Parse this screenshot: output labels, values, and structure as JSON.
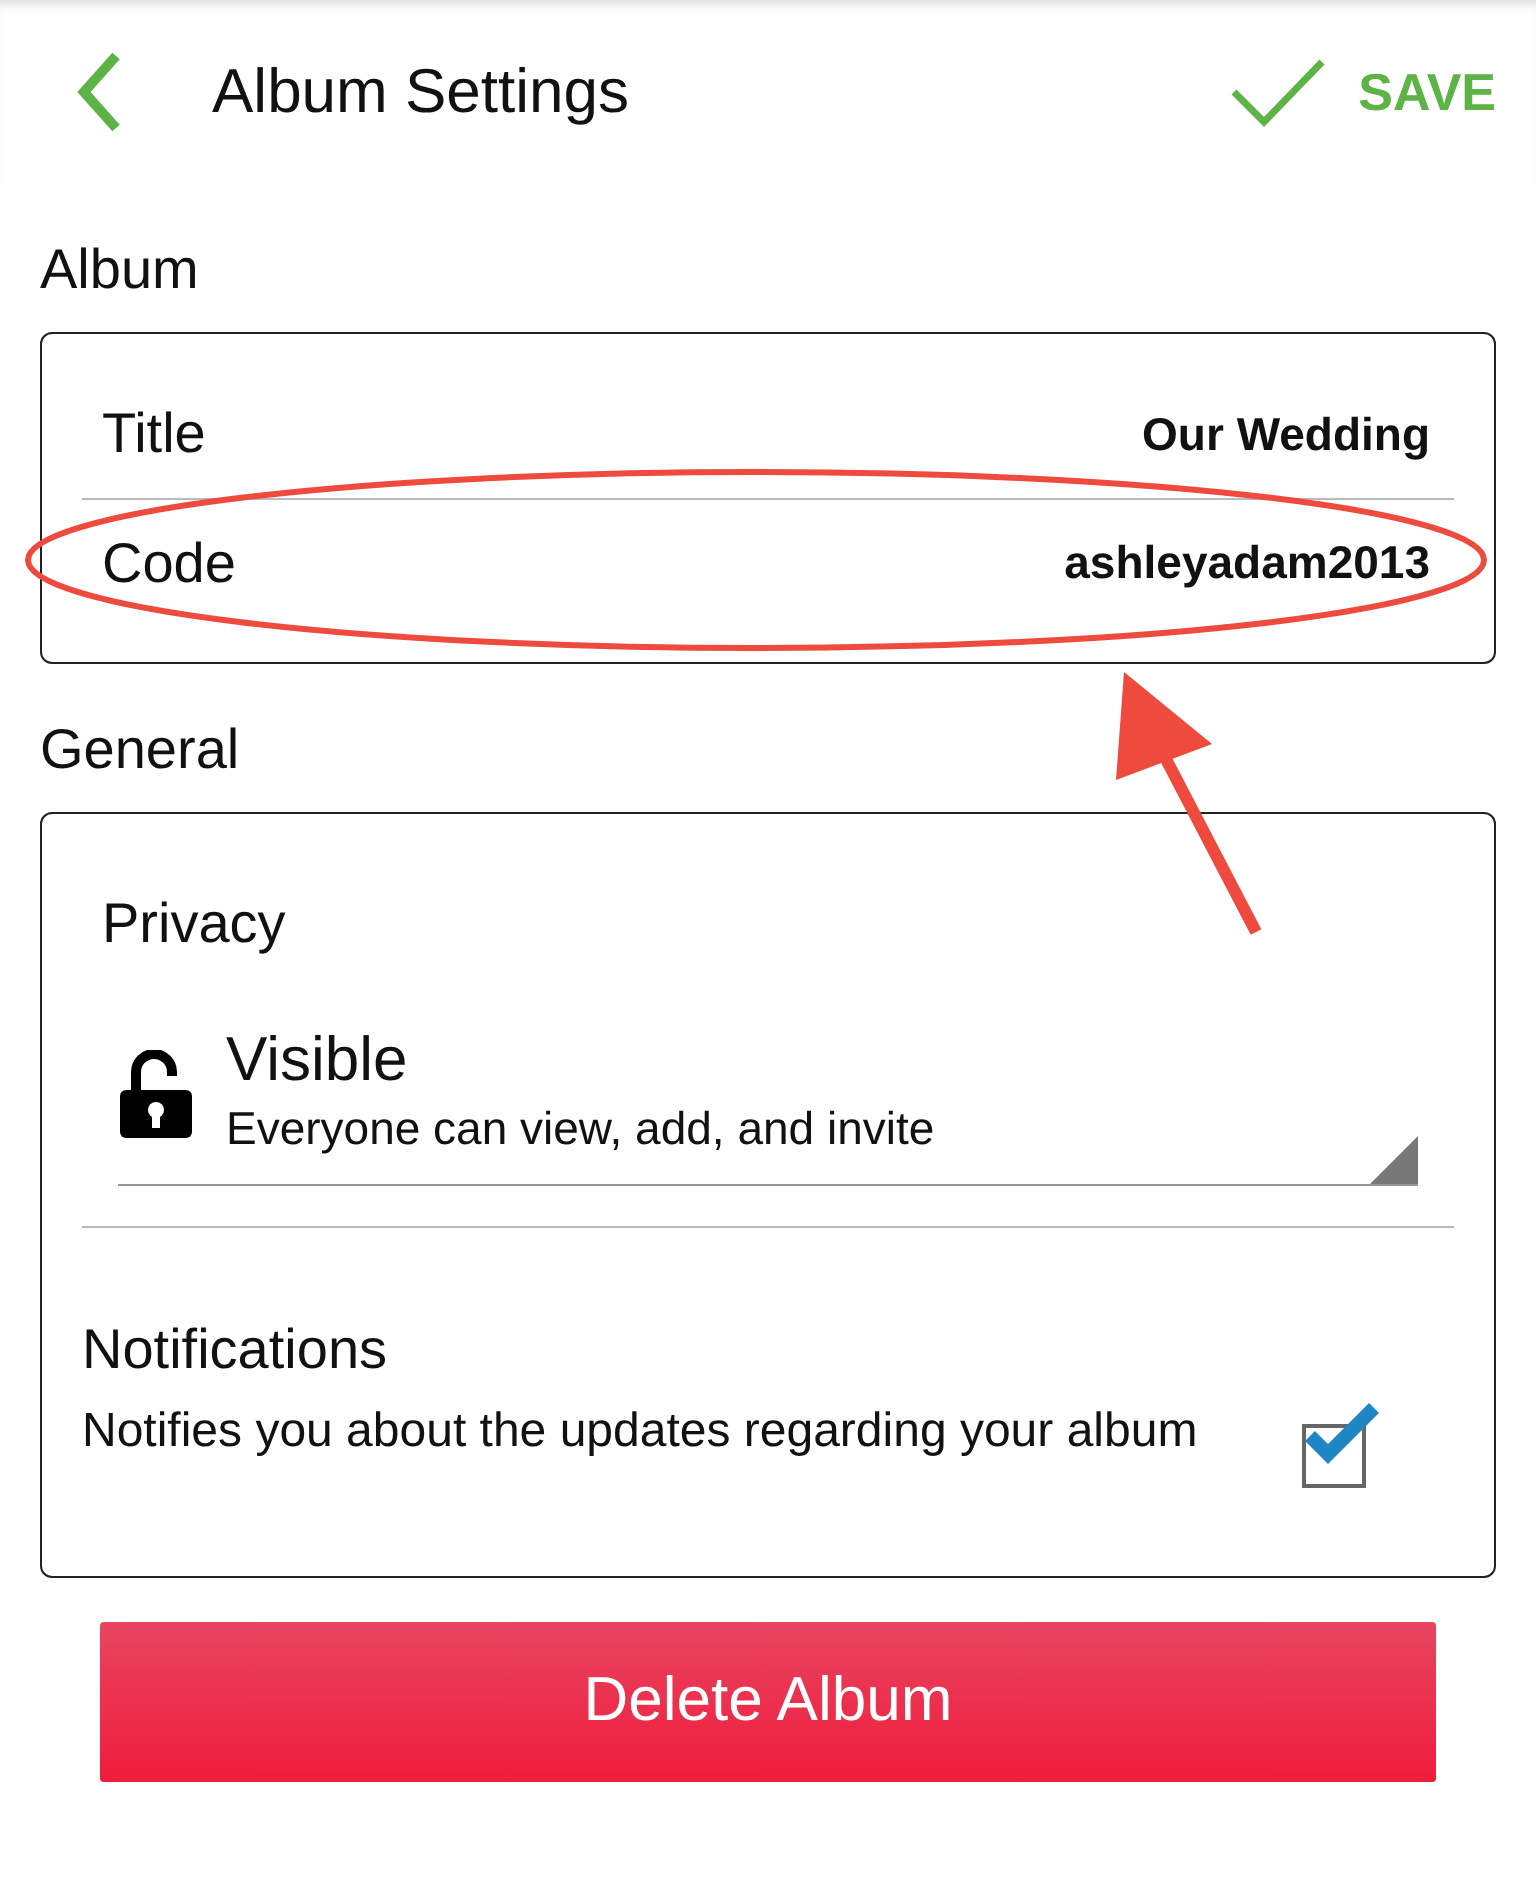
{
  "header": {
    "title": "Album Settings",
    "save_label": "SAVE"
  },
  "sections": [
    {
      "label": "Album",
      "kind": "fields",
      "rows": [
        {
          "label": "Title",
          "value": "Our Wedding"
        },
        {
          "label": "Code",
          "value": "ashleyadam2013"
        }
      ]
    },
    {
      "label": "General",
      "kind": "general",
      "privacy": {
        "label": "Privacy",
        "value": "Visible",
        "description": "Everyone can view, add, and invite"
      },
      "notifications": {
        "label": "Notifications",
        "description": "Notifies you about the updates regarding your album",
        "checked": true
      }
    }
  ],
  "delete_button": "Delete Album"
}
